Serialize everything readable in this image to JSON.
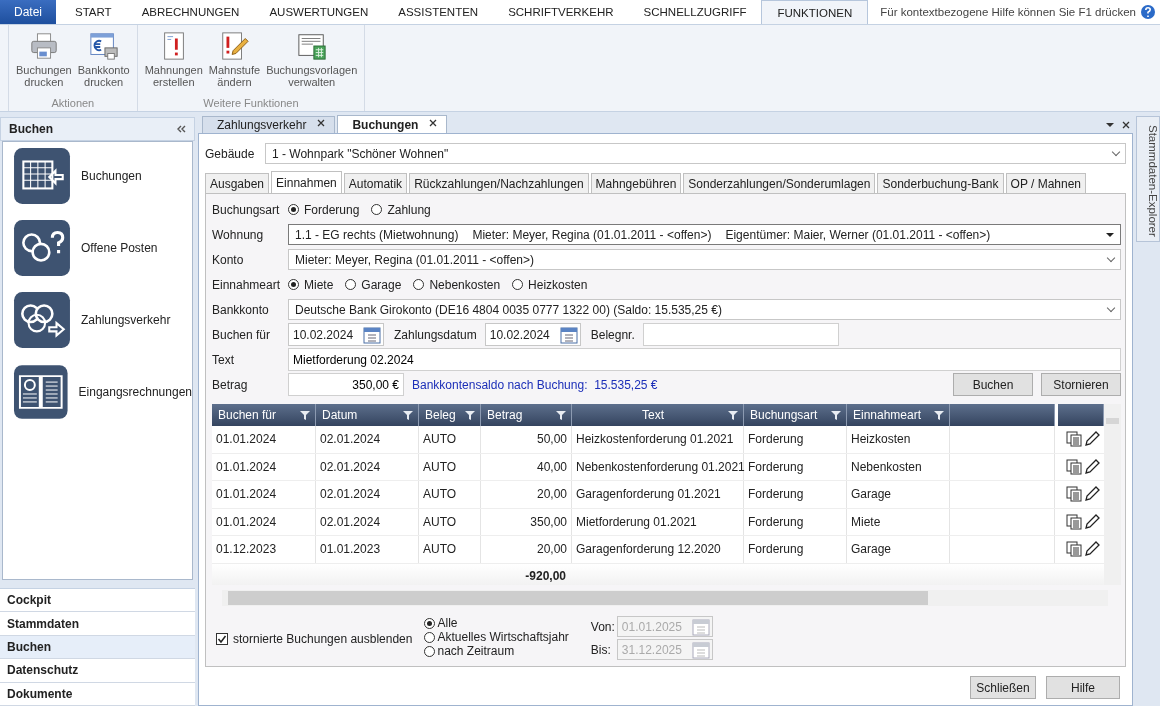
{
  "menu_tabs": [
    {
      "label": "Datei",
      "kind": "file",
      "selected": false
    },
    {
      "label": "START",
      "kind": "tab",
      "selected": false
    },
    {
      "label": "ABRECHNUNGEN",
      "kind": "tab",
      "selected": false
    },
    {
      "label": "AUSWERTUNGEN",
      "kind": "tab",
      "selected": false
    },
    {
      "label": "ASSISTENTEN",
      "kind": "tab",
      "selected": false
    },
    {
      "label": "SCHRIFTVERKEHR",
      "kind": "tab",
      "selected": false
    },
    {
      "label": "SCHNELLZUGRIFF",
      "kind": "tab",
      "selected": false
    },
    {
      "label": "FUNKTIONEN",
      "kind": "tab",
      "selected": true
    }
  ],
  "help_hint": "Für kontextbezogene Hilfe können Sie F1 drücken",
  "ribbon_groups": [
    {
      "label": "Aktionen",
      "buttons": [
        {
          "lines": [
            "Buchungen",
            "drucken"
          ]
        },
        {
          "lines": [
            "Bankkonto",
            "drucken"
          ]
        }
      ]
    },
    {
      "label": "Weitere Funktionen",
      "buttons": [
        {
          "lines": [
            "Mahnungen",
            "erstellen"
          ]
        },
        {
          "lines": [
            "Mahnstufe",
            "ändern"
          ]
        },
        {
          "lines": [
            "Buchungsvorlagen",
            "verwalten"
          ]
        }
      ]
    }
  ],
  "sidebar": {
    "title": "Buchen",
    "items": [
      {
        "label": "Buchungen"
      },
      {
        "label": "Offene Posten"
      },
      {
        "label": "Zahlungsverkehr"
      },
      {
        "label": "Eingangsrechnungen"
      }
    ],
    "nav": [
      {
        "label": "Cockpit",
        "selected": false
      },
      {
        "label": "Stammdaten",
        "selected": false
      },
      {
        "label": "Buchen",
        "selected": true
      },
      {
        "label": "Datenschutz",
        "selected": false
      },
      {
        "label": "Dokumente",
        "selected": false
      }
    ]
  },
  "doc_tabs": [
    {
      "label": "Zahlungsverkehr",
      "selected": false
    },
    {
      "label": "Buchungen",
      "selected": true
    }
  ],
  "side_panel": "Stammdaten-Explorer",
  "gebaeude": {
    "label": "Gebäude",
    "value": "1 - Wohnpark \"Schöner Wohnen\""
  },
  "sub_tabs": [
    {
      "label": "Ausgaben",
      "selected": false
    },
    {
      "label": "Einnahmen",
      "selected": true
    },
    {
      "label": "Automatik",
      "selected": false
    },
    {
      "label": "Rückzahlungen/Nachzahlungen",
      "selected": false
    },
    {
      "label": "Mahngebühren",
      "selected": false
    },
    {
      "label": "Sonderzahlungen/Sonderumlagen",
      "selected": false
    },
    {
      "label": "Sonderbuchung-Bank",
      "selected": false
    },
    {
      "label": "OP / Mahnen",
      "selected": false
    }
  ],
  "buchungsart": {
    "label": "Buchungsart",
    "options": [
      {
        "label": "Forderung",
        "selected": true
      },
      {
        "label": "Zahlung",
        "selected": false
      }
    ]
  },
  "wohnung": {
    "label": "Wohnung",
    "parts": [
      "1.1 - EG rechts (Mietwohnung)",
      "Mieter: Meyer, Regina (01.01.2011 - <offen>)",
      "Eigentümer: Maier, Werner (01.01.2011 - <offen>)"
    ]
  },
  "konto": {
    "label": "Konto",
    "value": "Mieter: Meyer, Regina (01.01.2011 - <offen>)"
  },
  "einnahmeart": {
    "label": "Einnahmeart",
    "options": [
      {
        "label": "Miete",
        "selected": true
      },
      {
        "label": "Garage",
        "selected": false
      },
      {
        "label": "Nebenkosten",
        "selected": false
      },
      {
        "label": "Heizkosten",
        "selected": false
      }
    ]
  },
  "bankkonto": {
    "label": "Bankkonto",
    "value": "Deutsche Bank Girokonto (DE16 4804 0035 0777 1322 00) (Saldo: 15.535,25 €)"
  },
  "buchen_fuer": {
    "label": "Buchen für",
    "value": "10.02.2024"
  },
  "zahlungsdatum": {
    "label": "Zahlungsdatum",
    "value": "10.02.2024"
  },
  "belegnr": {
    "label": "Belegnr."
  },
  "text": {
    "label": "Text",
    "value": "Mietforderung 02.2024"
  },
  "betrag": {
    "label": "Betrag",
    "value": "350,00 €"
  },
  "saldo_note": "Bankkontensaldo nach Buchung:  15.535,25 €",
  "form_buttons": [
    "Buchen",
    "Stornieren"
  ],
  "table": {
    "columns": [
      "Buchen für",
      "Datum",
      "Beleg",
      "Betrag",
      "Text",
      "Buchungsart",
      "Einnahmeart"
    ],
    "rows": [
      [
        "01.01.2024",
        "02.01.2024",
        "AUTO",
        "50,00",
        "Heizkostenforderung 01.2021",
        "Forderung",
        "Heizkosten"
      ],
      [
        "01.01.2024",
        "02.01.2024",
        "AUTO",
        "40,00",
        "Nebenkostenforderung 01.2021",
        "Forderung",
        "Nebenkosten"
      ],
      [
        "01.01.2024",
        "02.01.2024",
        "AUTO",
        "20,00",
        "Garagenforderung 01.2021",
        "Forderung",
        "Garage"
      ],
      [
        "01.01.2024",
        "02.01.2024",
        "AUTO",
        "350,00",
        "Mietforderung 01.2021",
        "Forderung",
        "Miete"
      ],
      [
        "01.12.2023",
        "01.01.2023",
        "AUTO",
        "20,00",
        "Garagenforderung 12.2020",
        "Forderung",
        "Garage"
      ]
    ],
    "total": "-920,00"
  },
  "hide_cancelled": {
    "label": "stornierte Buchungen ausblenden",
    "checked": true
  },
  "period": [
    {
      "label": "Alle",
      "selected": true
    },
    {
      "label": "Aktuelles Wirtschaftsjahr",
      "selected": false
    },
    {
      "label": "nach Zeitraum",
      "selected": false
    }
  ],
  "von": {
    "label": "Von:",
    "value": "01.01.2025",
    "disabled": true
  },
  "bis": {
    "label": "Bis:",
    "value": "31.12.2025",
    "disabled": true
  },
  "bottom_buttons": [
    "Schließen",
    "Hilfe"
  ]
}
